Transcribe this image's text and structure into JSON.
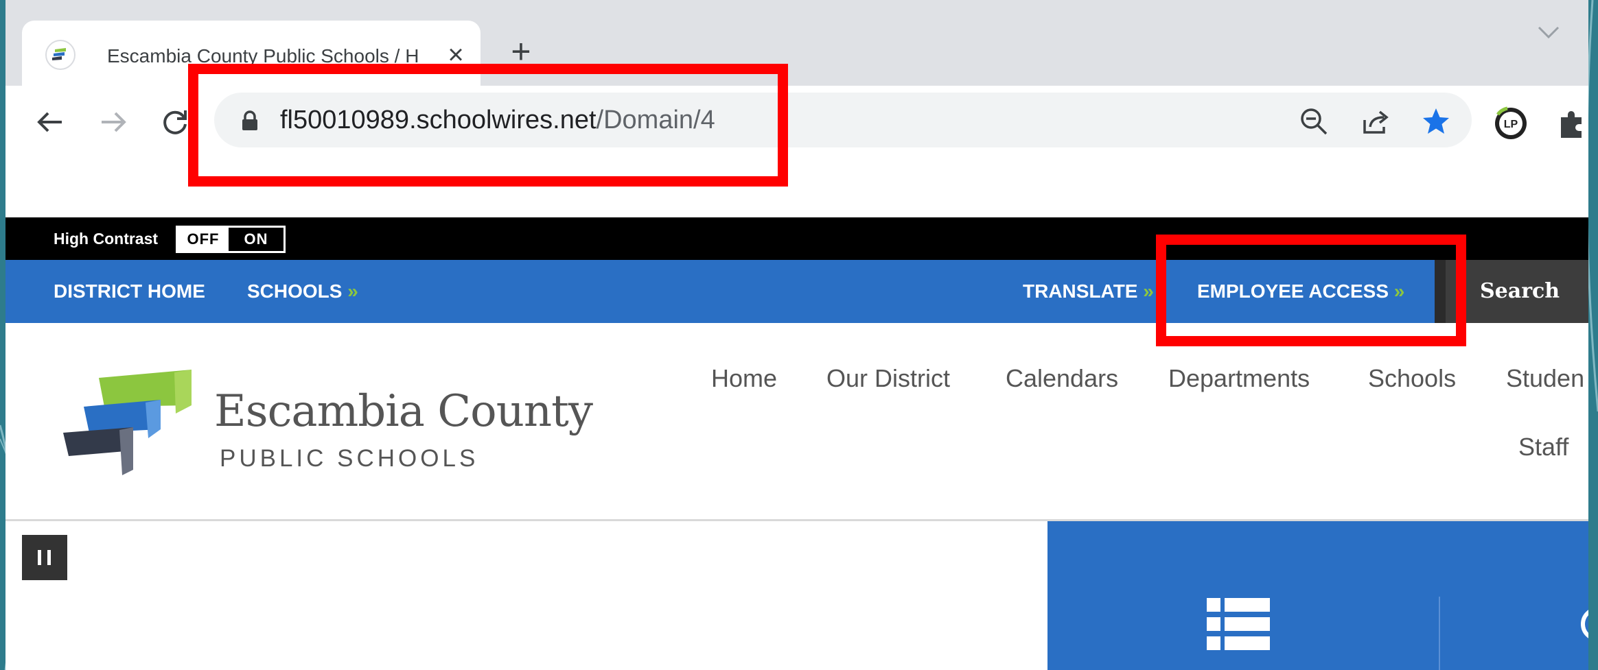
{
  "browser": {
    "tab": {
      "title": "Escambia County Public Schools / H",
      "close_glyph": "×"
    },
    "new_tab_glyph": "+",
    "url": {
      "host": "fl50010989.schoolwires.net",
      "path": "/Domain/4"
    },
    "icons": [
      "back-icon",
      "forward-icon",
      "reload-icon",
      "lock-icon",
      "zoom-out-icon",
      "share-icon",
      "bookmark-star-icon",
      "lastpass-icon",
      "extensions-icon",
      "tab-search-chevron-icon"
    ],
    "extension_badge": "LP"
  },
  "site": {
    "high_contrast": {
      "label": "High Contrast",
      "off": "OFF",
      "on": "ON"
    },
    "top_nav": {
      "district_home": "DISTRICT HOME",
      "schools": "SCHOOLS",
      "translate": "TRANSLATE",
      "employee_access": "EMPLOYEE ACCESS",
      "chevron": "»",
      "search": "Search"
    },
    "logo": {
      "name": "Escambia County",
      "subtitle": "PUBLIC SCHOOLS"
    },
    "main_nav": [
      "Home",
      "Our District",
      "Calendars",
      "Departments",
      "Schools",
      "Studen",
      "Staff"
    ]
  },
  "colors": {
    "brand_blue": "#2a6fc4",
    "accent_green": "#8cc63f",
    "annotation_red": "#ff0000",
    "slide_background": "#2e7c8c"
  }
}
